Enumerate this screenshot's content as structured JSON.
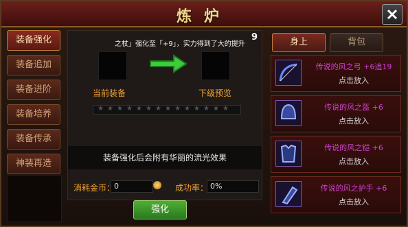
{
  "header": {
    "title": "炼炉"
  },
  "leftnav": {
    "items": [
      {
        "label": "装备强化",
        "active": true
      },
      {
        "label": "装备追加",
        "active": false
      },
      {
        "label": "装备进阶",
        "active": false
      },
      {
        "label": "装备培养",
        "active": false
      },
      {
        "label": "装备传承",
        "active": false
      },
      {
        "label": "神装再造",
        "active": false
      }
    ]
  },
  "center": {
    "marquee": "之杖」强化至「+9」，实力得到了大的提升",
    "level_badge": "9",
    "current_label": "当前装备",
    "next_label": "下级预览",
    "effect_text": "装备强化后会附有华丽的流光效果",
    "coins_label": "消耗金币：",
    "coins_value": "0",
    "rate_label": "成功率：",
    "rate_value": "0%",
    "enhance_button": "强化"
  },
  "rightpanel": {
    "tab_on": "身上",
    "tab_off": "背包",
    "items": [
      {
        "name": "传说的风之弓 +6追19",
        "hint": "点击放入",
        "icon": "bow-icon"
      },
      {
        "name": "传说的风之盔 +6",
        "hint": "点击放入",
        "icon": "helmet-icon"
      },
      {
        "name": "传说的风之铠 +6",
        "hint": "点击放入",
        "icon": "armor-icon"
      },
      {
        "name": "传说的风之护手 +6",
        "hint": "点击放入",
        "icon": "gauntlet-icon"
      }
    ]
  },
  "colors": {
    "accent": "#f0a030",
    "item_name": "#d040d0",
    "enhance_green": "#4fae35"
  }
}
